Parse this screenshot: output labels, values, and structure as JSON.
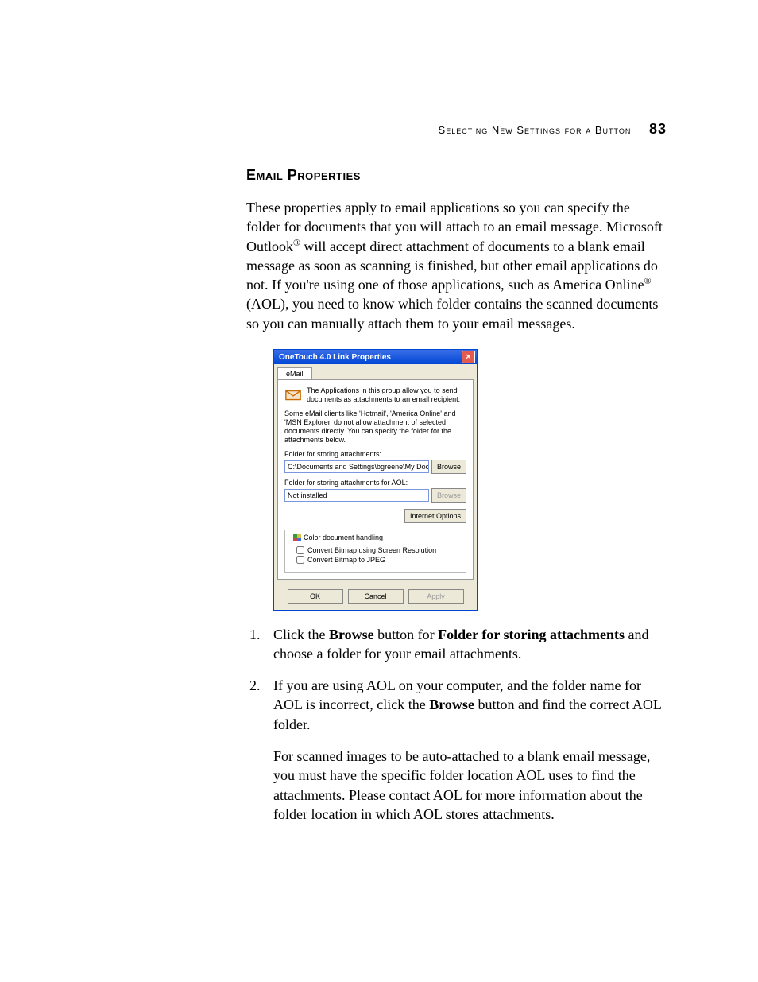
{
  "header": {
    "section_title": "Selecting New Settings for a Button",
    "page_number": "83"
  },
  "section_heading": "Email Properties",
  "intro_parts": {
    "p1": "These properties apply to email applications so you can specify the folder for documents that you will attach to an email message. Microsoft Outlook",
    "p2": " will accept direct attachment of documents to a blank email message as soon as scanning is finished, but other email applications do not. If you're using one of those applications, such as America Online",
    "p3": " (AOL), you need to know which folder contains the scanned documents so you can manually attach them to your email messages."
  },
  "dialog": {
    "title": "OneTouch 4.0 Link Properties",
    "tab_label": "eMail",
    "icon_desc": "The Applications in this group allow you to send documents as attachments to an email recipient.",
    "clients_note": "Some eMail clients like 'Hotmail', 'America Online' and 'MSN Explorer' do not allow attachment of selected documents directly. You can specify the folder for the attachments below.",
    "folder_label": "Folder for storing attachments:",
    "folder_value": "C:\\Documents and Settings\\bgreene\\My Docume",
    "browse_label": "Browse",
    "aol_label": "Folder for storing attachments for AOL:",
    "aol_value": "Not installed",
    "browse2_label": "Browse",
    "internet_options": "Internet Options",
    "group_title": "Color document handling",
    "cb1": "Convert Bitmap using Screen Resolution",
    "cb2": "Convert Bitmap to JPEG",
    "ok": "OK",
    "cancel": "Cancel",
    "apply": "Apply"
  },
  "steps": {
    "s1a": "Click the ",
    "s1_bold1": "Browse",
    "s1b": " button for ",
    "s1_bold2": "Folder for storing attachments",
    "s1c": " and choose a folder for your email attachments.",
    "s2a": "If you are using AOL on your computer, and the folder name for AOL is incorrect, click the ",
    "s2_bold": "Browse",
    "s2b": " button and find the correct AOL folder."
  },
  "followup": "For scanned images to be auto-attached to a blank email message, you must have the specific folder location AOL uses to find the attachments. Please contact AOL for more information about the folder location in which AOL stores attachments."
}
